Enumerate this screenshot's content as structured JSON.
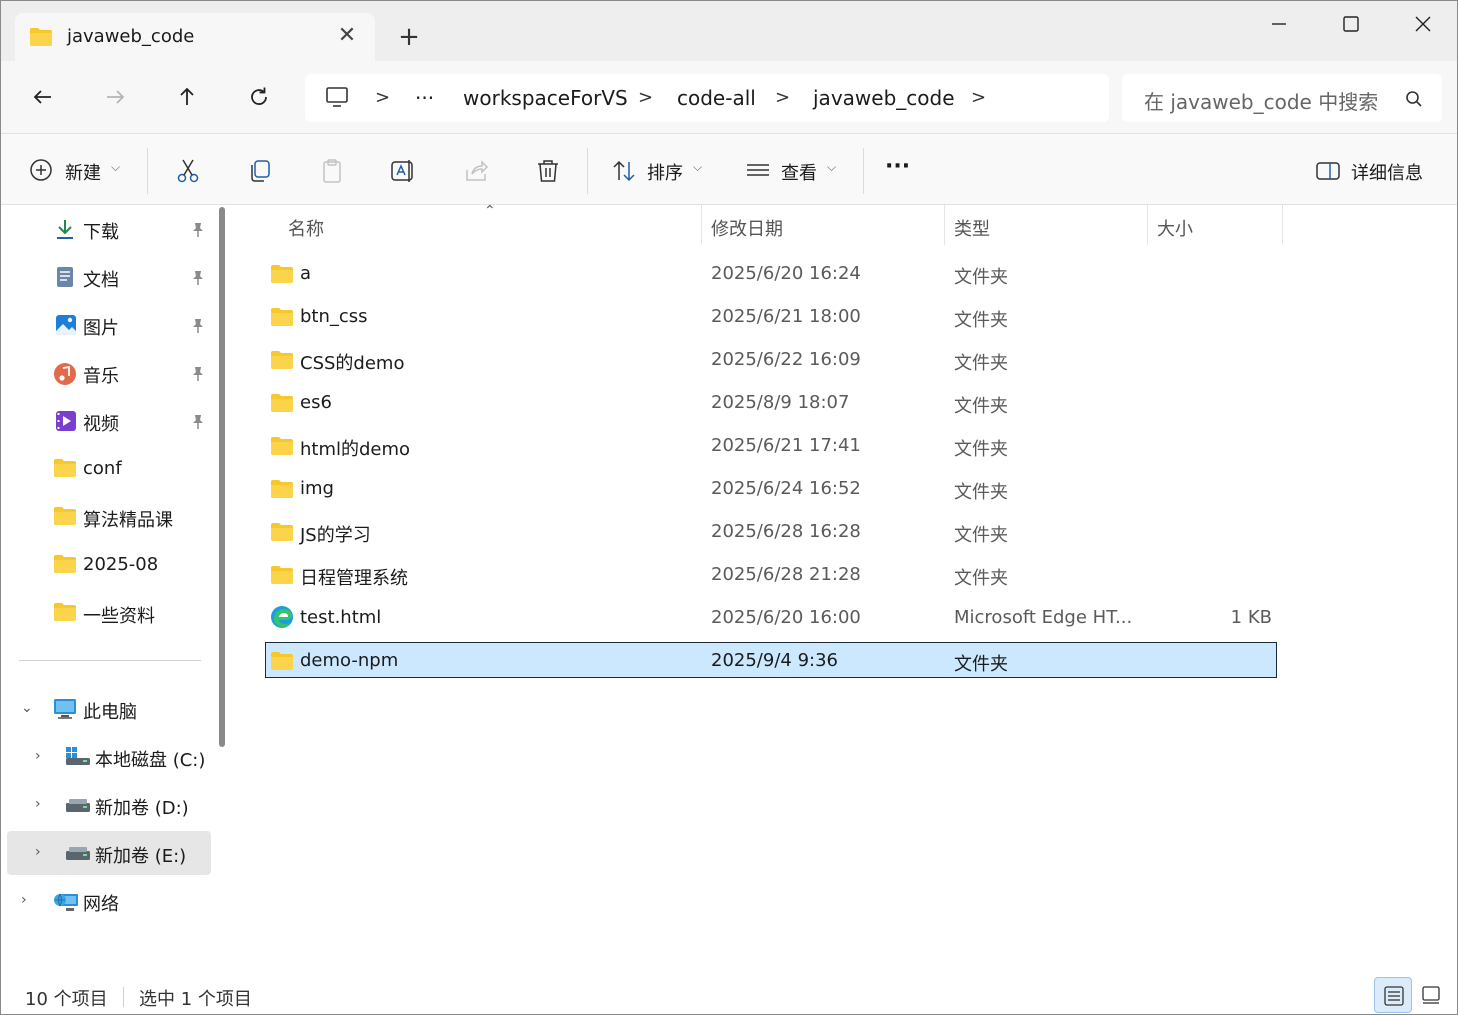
{
  "window": {
    "tab_title": "javaweb_code",
    "tab_close": "✕",
    "new_tab": "+"
  },
  "nav": {
    "breadcrumb": [
      "workspaceForVS",
      "code-all",
      "javaweb_code"
    ],
    "ellipsis": "···",
    "search_placeholder": "在 javaweb_code 中搜索"
  },
  "toolbar": {
    "new_label": "新建",
    "sort_label": "排序",
    "view_label": "查看",
    "more_label": "···",
    "details_label": "详细信息"
  },
  "sidebar": {
    "quick_access": [
      {
        "label": "下载",
        "icon": "download-icon",
        "pinned": true
      },
      {
        "label": "文档",
        "icon": "documents-icon",
        "pinned": true
      },
      {
        "label": "图片",
        "icon": "pictures-icon",
        "pinned": true
      },
      {
        "label": "音乐",
        "icon": "music-icon",
        "pinned": true
      },
      {
        "label": "视频",
        "icon": "videos-icon",
        "pinned": true
      },
      {
        "label": "conf",
        "icon": "folder-icon",
        "pinned": false
      },
      {
        "label": "算法精品课",
        "icon": "folder-icon",
        "pinned": false
      },
      {
        "label": "2025-08",
        "icon": "folder-icon",
        "pinned": false
      },
      {
        "label": "一些资料",
        "icon": "folder-icon",
        "pinned": false
      }
    ],
    "this_pc": "此电脑",
    "drives": [
      {
        "label": "本地磁盘 (C:)",
        "icon": "windows-drive-icon",
        "selected": false
      },
      {
        "label": "新加卷 (D:)",
        "icon": "drive-icon",
        "selected": false
      },
      {
        "label": "新加卷 (E:)",
        "icon": "drive-icon",
        "selected": true
      }
    ],
    "network": "网络"
  },
  "columns": {
    "name": "名称",
    "date": "修改日期",
    "type": "类型",
    "size": "大小"
  },
  "files": [
    {
      "name": "a",
      "date": "2025/6/20 16:24",
      "type": "文件夹",
      "size": "",
      "icon": "folder-icon",
      "selected": false
    },
    {
      "name": "btn_css",
      "date": "2025/6/21 18:00",
      "type": "文件夹",
      "size": "",
      "icon": "folder-icon",
      "selected": false
    },
    {
      "name": "CSS的demo",
      "date": "2025/6/22 16:09",
      "type": "文件夹",
      "size": "",
      "icon": "folder-icon",
      "selected": false
    },
    {
      "name": "es6",
      "date": "2025/8/9 18:07",
      "type": "文件夹",
      "size": "",
      "icon": "folder-icon",
      "selected": false
    },
    {
      "name": "html的demo",
      "date": "2025/6/21 17:41",
      "type": "文件夹",
      "size": "",
      "icon": "folder-icon",
      "selected": false
    },
    {
      "name": "img",
      "date": "2025/6/24 16:52",
      "type": "文件夹",
      "size": "",
      "icon": "folder-icon",
      "selected": false
    },
    {
      "name": "JS的学习",
      "date": "2025/6/28 16:28",
      "type": "文件夹",
      "size": "",
      "icon": "folder-icon",
      "selected": false
    },
    {
      "name": "日程管理系统",
      "date": "2025/6/28 21:28",
      "type": "文件夹",
      "size": "",
      "icon": "folder-icon",
      "selected": false
    },
    {
      "name": "test.html",
      "date": "2025/6/20 16:00",
      "type": "Microsoft Edge HT...",
      "size": "1 KB",
      "icon": "edge-icon",
      "selected": false
    },
    {
      "name": "demo-npm",
      "date": "2025/9/4 9:36",
      "type": "文件夹",
      "size": "",
      "icon": "folder-icon",
      "selected": true
    }
  ],
  "status": {
    "item_count": "10 个项目",
    "selected_count": "选中 1 个项目"
  },
  "colors": {
    "folder": "#f8c72a",
    "selection": "#cce8ff",
    "accent": "#0067c0"
  }
}
